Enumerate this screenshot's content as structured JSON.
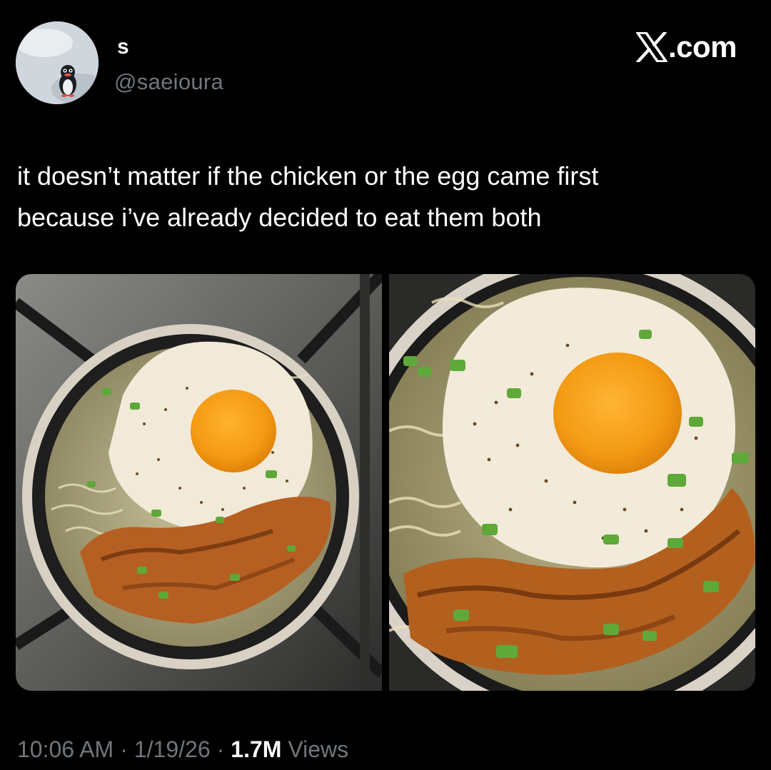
{
  "author": {
    "display_name": "s",
    "handle": "@saeioura",
    "avatar": "penguin-avatar"
  },
  "brand": {
    "text": ".com",
    "logo": "x-logo-icon"
  },
  "tweet": {
    "line1": "it doesn’t matter if the chicken or the egg came first",
    "line2": "because i’ve already decided to eat them both"
  },
  "media": [
    {
      "name": "photo-bowl-stovetop",
      "kind": "photo"
    },
    {
      "name": "photo-bowl-closeup",
      "kind": "photo"
    }
  ],
  "meta": {
    "time": "10:06 AM",
    "separator": "·",
    "date": "1/19/26",
    "views_count": "1.7M",
    "views_label": "Views"
  },
  "colors": {
    "background": "#000000",
    "primary_text": "#ffffff",
    "secondary_text": "#71767b"
  }
}
